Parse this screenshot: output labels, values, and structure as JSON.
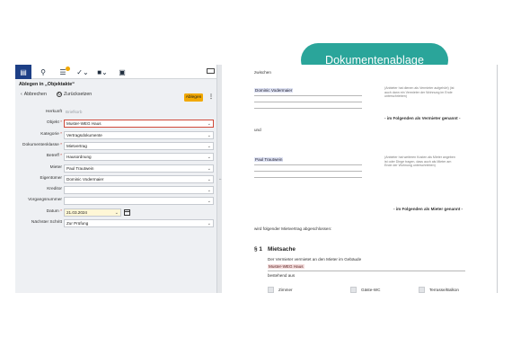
{
  "badge": {
    "label": "Dokumentenablage",
    "color": "#2aa59a"
  },
  "toolbar": {
    "icons": [
      "inbox-icon",
      "search-icon",
      "list-icon",
      "check-icon",
      "folder-icon",
      "clipboard-icon"
    ],
    "accent": "#1d3f86"
  },
  "panel": {
    "title": "Ablegen in „Objektakte“",
    "back_label": "Abbrechen",
    "reset_label": "Zurücksetzen",
    "submit_label": "Ablegen",
    "submit_color": "#f2a900"
  },
  "fields": [
    {
      "label": "Herkunft",
      "required": false,
      "value": "Briefkorb",
      "type": "plain"
    },
    {
      "label": "Objekt",
      "required": true,
      "value": "Muster-WEG Haus",
      "type": "select",
      "error": true
    },
    {
      "label": "Kategorie",
      "required": true,
      "value": "Vertragsdokumente",
      "type": "select"
    },
    {
      "label": "Dokumentenklasse",
      "required": true,
      "value": "Mietvertrag",
      "type": "select"
    },
    {
      "label": "Betreff",
      "required": true,
      "value": "Hausordnung",
      "type": "select"
    },
    {
      "label": "Mieter",
      "required": false,
      "value": "Paul Trautwein",
      "type": "select"
    },
    {
      "label": "Eigentümer",
      "required": false,
      "value": "Dominic Vodermaier",
      "type": "select"
    },
    {
      "label": "Kreditor",
      "required": false,
      "value": "",
      "type": "select"
    },
    {
      "label": "Vorgangsnummer",
      "required": false,
      "value": "",
      "type": "select"
    },
    {
      "label": "Datum",
      "required": true,
      "value": "21.03.2024",
      "type": "date"
    },
    {
      "label": "Nächster Schritt",
      "required": false,
      "value": "Zur Prüfung",
      "type": "select"
    }
  ],
  "doc": {
    "zwischen": "zwischen",
    "landlord_name": "Dominic Vodermaier",
    "landlord_note": "(Anbieter hat dienen als Vermieter aufgehört) (ist auch dann ein Vermieter der Wohnung im Ende unterschrieben)",
    "landlord_role": "- im Folgenden als Vermieter genannt -",
    "und": "und",
    "tenant_name": "Paul Trautwein",
    "tenant_note": "(Anbieter hat weiteren Kosten als Mieter angeben ist oder Dinge tragen, dass auch als Mieter am Ende der Wohnung unterschrieben)",
    "tenant_role": "- im Folgenden als Mieter genannt -",
    "contract_intro": "wird folgender Mietvertrag abgeschlossen:",
    "section_num": "§ 1",
    "section_title": "Mietsache",
    "section_text": "Der Vermieter vermietet an den Mieter im Gebäude",
    "property": "Muster-WEG Haus",
    "consisting": "bestehend aus",
    "rooms": [
      "Zimmer",
      "Gäste-WC",
      "Terrasse/Balkon"
    ]
  }
}
